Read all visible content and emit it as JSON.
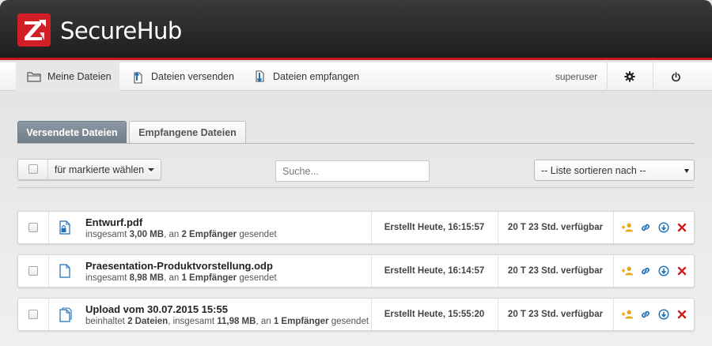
{
  "app": {
    "title": "SecureHub",
    "brand_color": "#d21e26"
  },
  "nav": {
    "items": [
      {
        "label": "Meine Dateien",
        "icon": "folder-icon",
        "active": true
      },
      {
        "label": "Dateien versenden",
        "icon": "upload-file-icon",
        "active": false
      },
      {
        "label": "Dateien empfangen",
        "icon": "download-file-icon",
        "active": false
      }
    ],
    "user": "superuser",
    "settings_icon": "gear-icon",
    "logout_icon": "power-icon"
  },
  "tabs": [
    {
      "label": "Versendete Dateien",
      "active": true
    },
    {
      "label": "Empfangene Dateien",
      "active": false
    }
  ],
  "toolbar": {
    "bulk_label": "für markierte wählen",
    "search_placeholder": "Suche...",
    "sort_label": "-- Liste sortieren nach --"
  },
  "files": [
    {
      "name": "Entwurf.pdf",
      "icon": "locked-file-icon",
      "desc_pre": "insgesamt ",
      "desc_size": "3,00 MB",
      "desc_mid": ", an ",
      "desc_recipients": "2 Empfänger",
      "desc_post": " gesendet",
      "created": "Erstellt Heute, 16:15:57",
      "available": "20 T 23 Std. verfügbar"
    },
    {
      "name": "Praesentation-Produktvorstellung.odp",
      "icon": "file-icon",
      "desc_pre": "insgesamt ",
      "desc_size": "8,98 MB",
      "desc_mid": ", an ",
      "desc_recipients": "1 Empfänger",
      "desc_post": " gesendet",
      "created": "Erstellt Heute, 16:14:57",
      "available": "20 T 23 Std. verfügbar"
    },
    {
      "name": "Upload vom 30.07.2015 15:55",
      "icon": "files-icon",
      "desc_pre": "beinhaltet ",
      "desc_count": "2 Dateien",
      "desc_mid0": ", insgesamt ",
      "desc_size": "11,98 MB",
      "desc_mid": ", an ",
      "desc_recipients": "1 Empfänger",
      "desc_post": " gesendet",
      "created": "Erstellt Heute, 15:55:20",
      "available": "20 T 23 Std. verfügbar"
    }
  ],
  "action_icons": [
    "add-recipient-icon",
    "link-icon",
    "download-icon",
    "delete-icon"
  ],
  "colors": {
    "tab_active": "#7b8995",
    "icon_blue": "#1d6fb8",
    "icon_gold": "#e6a817",
    "icon_red": "#cc1f1f"
  }
}
